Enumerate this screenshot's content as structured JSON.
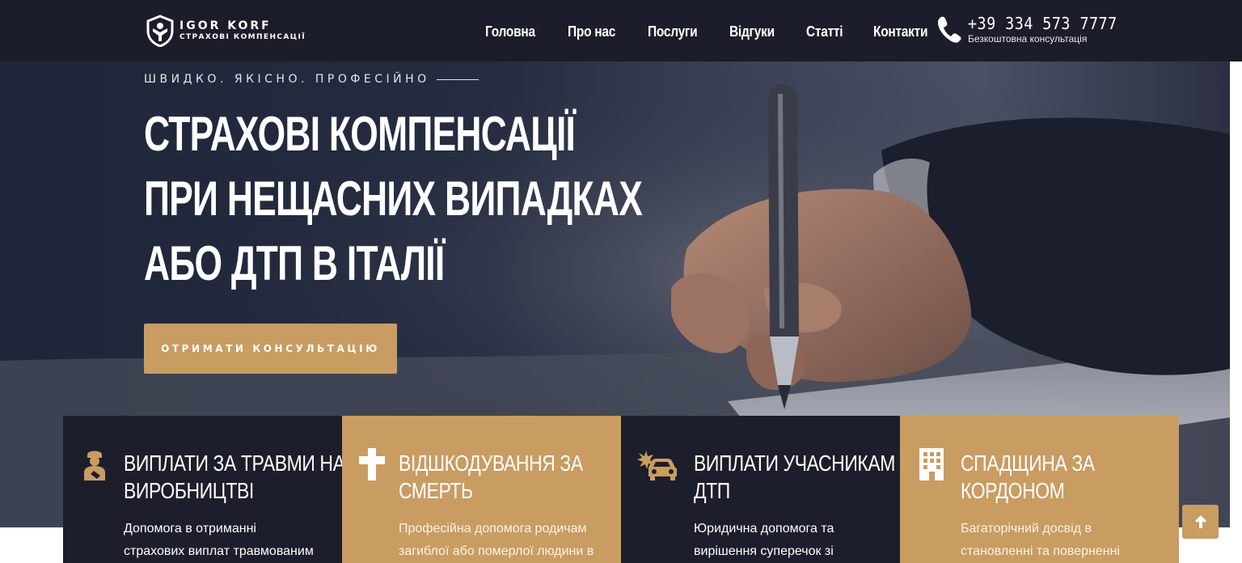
{
  "header": {
    "logo_name": "IGOR KORF",
    "logo_sub": "СТРАХОВІ КОМПЕНСАЦІЇ",
    "nav": [
      "Головна",
      "Про нас",
      "Послуги",
      "Відгуки",
      "Статті",
      "Контакти"
    ],
    "phone_number": "+39 334 573 7777",
    "phone_note": "Безкоштовна консультація",
    "icons": {
      "logo": "shield-person-logo",
      "phone": "phone-icon"
    }
  },
  "hero": {
    "tagline": "ШВИДКО. ЯКІСНО. ПРОФЕСІЙНО",
    "title_lines": [
      "СТРАХОВІ КОМПЕНСАЦІЇ",
      "ПРИ НЕЩАСНИХ ВИПАДКАХ",
      "АБО ДТП В ІТАЛІЇ"
    ],
    "cta_label": "ОТРИМАТИ КОНСУЛЬТАЦІЮ"
  },
  "cards": [
    {
      "icon": "injured-worker-icon",
      "title_lines": [
        "ВИПЛАТИ ЗА ТРАВМИ НА",
        "ВИРОБНИЦТВІ"
      ],
      "text_lines": [
        "Допомога в отриманні",
        "страхових виплат травмованим"
      ]
    },
    {
      "icon": "cross-icon",
      "title_lines": [
        "ВІДШКОДУВАННЯ ЗА",
        "СМЕРТЬ"
      ],
      "text_lines": [
        "Професійна допомога родичам",
        "загиблої або померлої людини в"
      ]
    },
    {
      "icon": "car-crash-icon",
      "title_lines": [
        "ВИПЛАТИ УЧАСНИКАМ",
        "ДТП"
      ],
      "text_lines": [
        "Юридична допомога та",
        "вирішення суперечок зі"
      ]
    },
    {
      "icon": "building-icon",
      "title_lines": [
        "СПАДЩИНА ЗА",
        "КОРДОНОМ"
      ],
      "text_lines": [
        "Багаторічний досвід в",
        "становленні та поверненні"
      ]
    }
  ],
  "colors": {
    "header_bg": "#1b1d2a",
    "accent": "#c99c62",
    "card_dark": "#1d1e2b"
  },
  "scroll_top_icon": "arrow-up-icon"
}
